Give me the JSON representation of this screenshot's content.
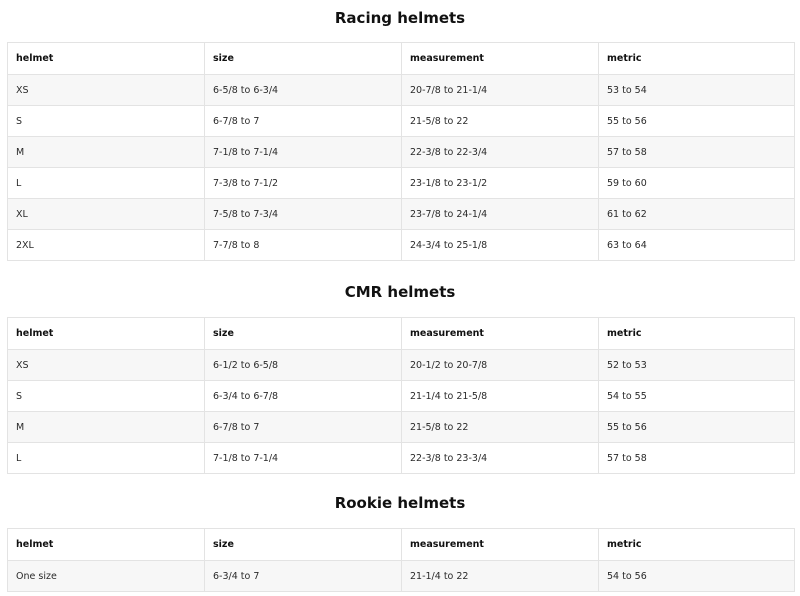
{
  "headers": [
    "helmet",
    "size",
    "measurement",
    "metric"
  ],
  "sections": [
    {
      "title": "Racing helmets",
      "rows": [
        [
          "XS",
          "6-5/8 to 6-3/4",
          "20-7/8 to 21-1/4",
          "53 to 54"
        ],
        [
          "S",
          "6-7/8 to 7",
          "21-5/8 to 22",
          "55 to 56"
        ],
        [
          "M",
          "7-1/8 to 7-1/4",
          "22-3/8 to 22-3/4",
          "57 to 58"
        ],
        [
          "L",
          "7-3/8 to 7-1/2",
          "23-1/8 to 23-1/2",
          "59 to 60"
        ],
        [
          "XL",
          "7-5/8 to 7-3/4",
          "23-7/8 to 24-1/4",
          "61 to 62"
        ],
        [
          "2XL",
          "7-7/8 to 8",
          "24-3/4 to 25-1/8",
          "63 to 64"
        ]
      ]
    },
    {
      "title": "CMR helmets",
      "rows": [
        [
          "XS",
          "6-1/2 to 6-5/8",
          "20-1/2 to 20-7/8",
          "52 to 53"
        ],
        [
          "S",
          "6-3/4 to 6-7/8",
          "21-1/4 to 21-5/8",
          "54 to 55"
        ],
        [
          "M",
          "6-7/8 to 7",
          "21-5/8 to 22",
          "55 to 56"
        ],
        [
          "L",
          "7-1/8 to 7-1/4",
          "22-3/8 to 23-3/4",
          "57 to 58"
        ]
      ]
    },
    {
      "title": "Rookie helmets",
      "rows": [
        [
          "One size",
          "6-3/4 to 7",
          "21-1/4 to 22",
          "54 to 56"
        ]
      ]
    }
  ]
}
